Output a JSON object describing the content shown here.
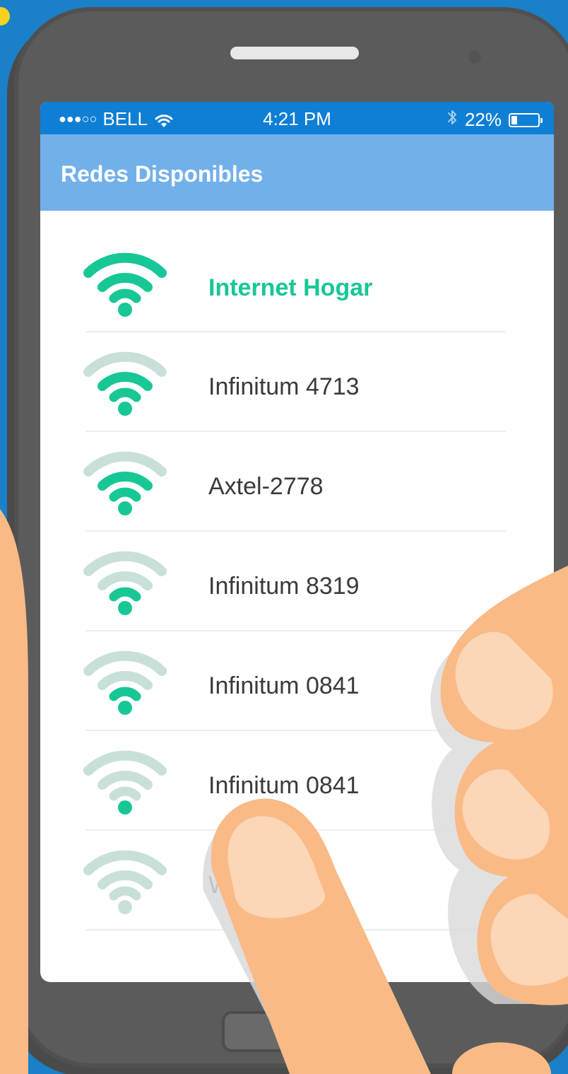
{
  "statusbar": {
    "signal_dots": "●●●○○",
    "carrier": "BELL",
    "wifi_glyph": "ᯤ",
    "time": "4:21 PM",
    "bluetooth_glyph": "ᛒ",
    "battery_percent": "22%",
    "battery_level": 0.22
  },
  "navbar": {
    "title": "Redes Disponibles"
  },
  "networks": [
    {
      "name": "Internet Hogar",
      "signal_bars": 3,
      "connected": true
    },
    {
      "name": "Infinitum 4713",
      "signal_bars": 2,
      "connected": false
    },
    {
      "name": "Axtel-2778",
      "signal_bars": 2,
      "connected": false
    },
    {
      "name": "Infinitum 8319",
      "signal_bars": 1,
      "connected": false
    },
    {
      "name": "Infinitum 0841",
      "signal_bars": 1,
      "connected": false
    },
    {
      "name": "Infinitum 0841",
      "signal_bars": 0,
      "connected": false
    },
    {
      "name": "W",
      "signal_bars": -1,
      "connected": false
    }
  ],
  "colors": {
    "background": "#1a80c8",
    "statusbar": "#0e7fd5",
    "navbar": "#72b0ea",
    "active": "#17c795",
    "inactive": "#c9e0da",
    "skin": "#f9ba86",
    "nail": "#fbd6b7"
  },
  "icons": {
    "wifi": "wifi-icon",
    "bluetooth": "bluetooth-icon",
    "battery": "battery-icon"
  }
}
